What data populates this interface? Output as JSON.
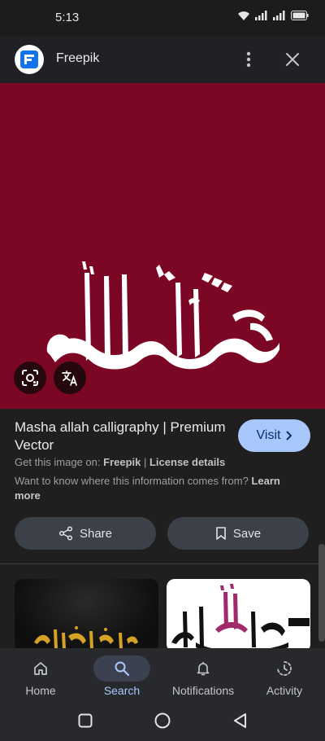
{
  "status_bar": {
    "time": "5:13"
  },
  "header": {
    "site_name": "Freepik",
    "logo_icon": "freepik-logo-icon",
    "more_icon": "more-vert-icon",
    "close_icon": "close-icon"
  },
  "preview": {
    "background_color": "#7b0724",
    "lens_icon": "google-lens-icon",
    "translate_icon": "translate-icon"
  },
  "details": {
    "title": "Masha allah calligraphy | Premium Vector",
    "visit_label": "Visit",
    "source_prefix": "Get this image on: ",
    "source_site": "Freepik",
    "separator": " | ",
    "license_label": "License details",
    "info_text": "Want to know where this information comes from? ",
    "learn_more": "Learn more",
    "share_label": "Share",
    "save_label": "Save"
  },
  "bottom_nav": {
    "items": [
      {
        "label": "Home",
        "icon": "home-icon",
        "active": false
      },
      {
        "label": "Search",
        "icon": "search-icon",
        "active": true
      },
      {
        "label": "Notifications",
        "icon": "bell-icon",
        "active": false
      },
      {
        "label": "Activity",
        "icon": "activity-icon",
        "active": false
      }
    ]
  },
  "system_nav": {
    "recents_icon": "recents-square-icon",
    "home_icon": "home-circle-icon",
    "back_icon": "back-triangle-icon"
  },
  "colors": {
    "accent": "#a8c7fa",
    "visit_text": "#062e6f",
    "preview_bg": "#7b0724"
  }
}
